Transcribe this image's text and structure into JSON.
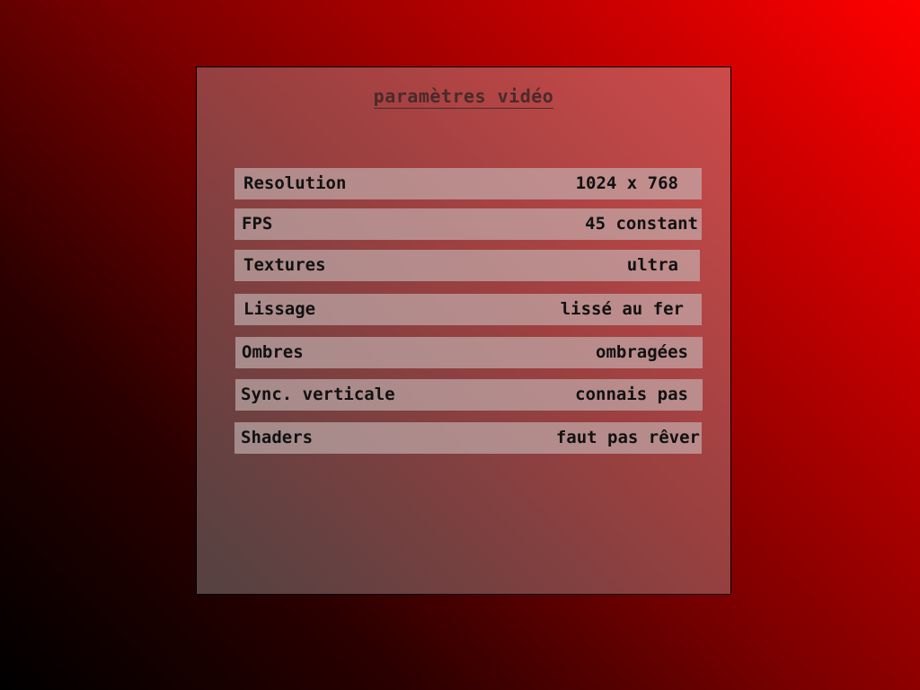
{
  "menu": {
    "title": "paramètres vidéo",
    "options": [
      {
        "label": "Resolution",
        "value": "1024 x 768"
      },
      {
        "label": "FPS",
        "value": "45 constant"
      },
      {
        "label": "Textures",
        "value": "ultra"
      },
      {
        "label": "Lissage",
        "value": "lissé au fer"
      },
      {
        "label": "Ombres",
        "value": "ombragées"
      },
      {
        "label": "Sync. verticale",
        "value": "connais pas"
      },
      {
        "label": "Shaders",
        "value": "faut pas rêver"
      }
    ]
  },
  "colors": {
    "background_accent": "#ff0000",
    "panel_tint": "#a06060",
    "row_fill": "#c8b9b9",
    "text": "#111111",
    "title_text": "#4a2a2a"
  }
}
